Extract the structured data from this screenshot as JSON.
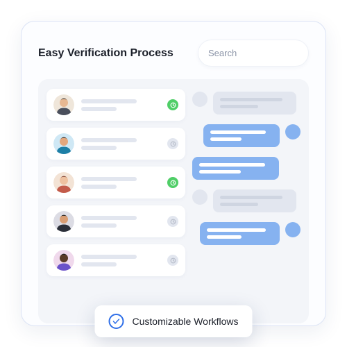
{
  "header": {
    "title": "Easy Verification Process",
    "search_placeholder": "Search"
  },
  "contacts": [
    {
      "status": "online",
      "avatar": {
        "bg": "#efe6da",
        "hair": "#3a2f26",
        "skin": "#e8b892",
        "shirt": "#4a4f5c"
      }
    },
    {
      "status": "offline",
      "avatar": {
        "bg": "#cfe8f5",
        "hair": "#2b2420",
        "skin": "#e3a77d",
        "shirt": "#1d7fa6"
      }
    },
    {
      "status": "online",
      "avatar": {
        "bg": "#f3e3d5",
        "hair": "#7a3b2a",
        "skin": "#eec1a0",
        "shirt": "#c35b4a"
      }
    },
    {
      "status": "offline",
      "avatar": {
        "bg": "#dcdce4",
        "hair": "#1a1a1a",
        "skin": "#d99e74",
        "shirt": "#2b2f39"
      }
    },
    {
      "status": "offline",
      "avatar": {
        "bg": "#f0d9ec",
        "hair": "#1a1a1a",
        "skin": "#5a3b28",
        "shirt": "#6a52c9"
      }
    }
  ],
  "chat": [
    {
      "side": "left",
      "color": "grey",
      "widths": [
        90,
        55
      ]
    },
    {
      "side": "right",
      "color": "blue",
      "widths": [
        80,
        45
      ]
    },
    {
      "side": "left",
      "color": "blue",
      "widths": [
        95,
        60
      ],
      "no_avatar": true
    },
    {
      "side": "left",
      "color": "grey",
      "widths": [
        90,
        55
      ]
    },
    {
      "side": "right",
      "color": "blue",
      "widths": [
        85,
        50
      ]
    }
  ],
  "toast": {
    "label": "Customizable Workflows"
  },
  "colors": {
    "accent_blue": "#2f6fe8",
    "bubble_blue": "#86b2f0",
    "status_green": "#4fce67"
  }
}
